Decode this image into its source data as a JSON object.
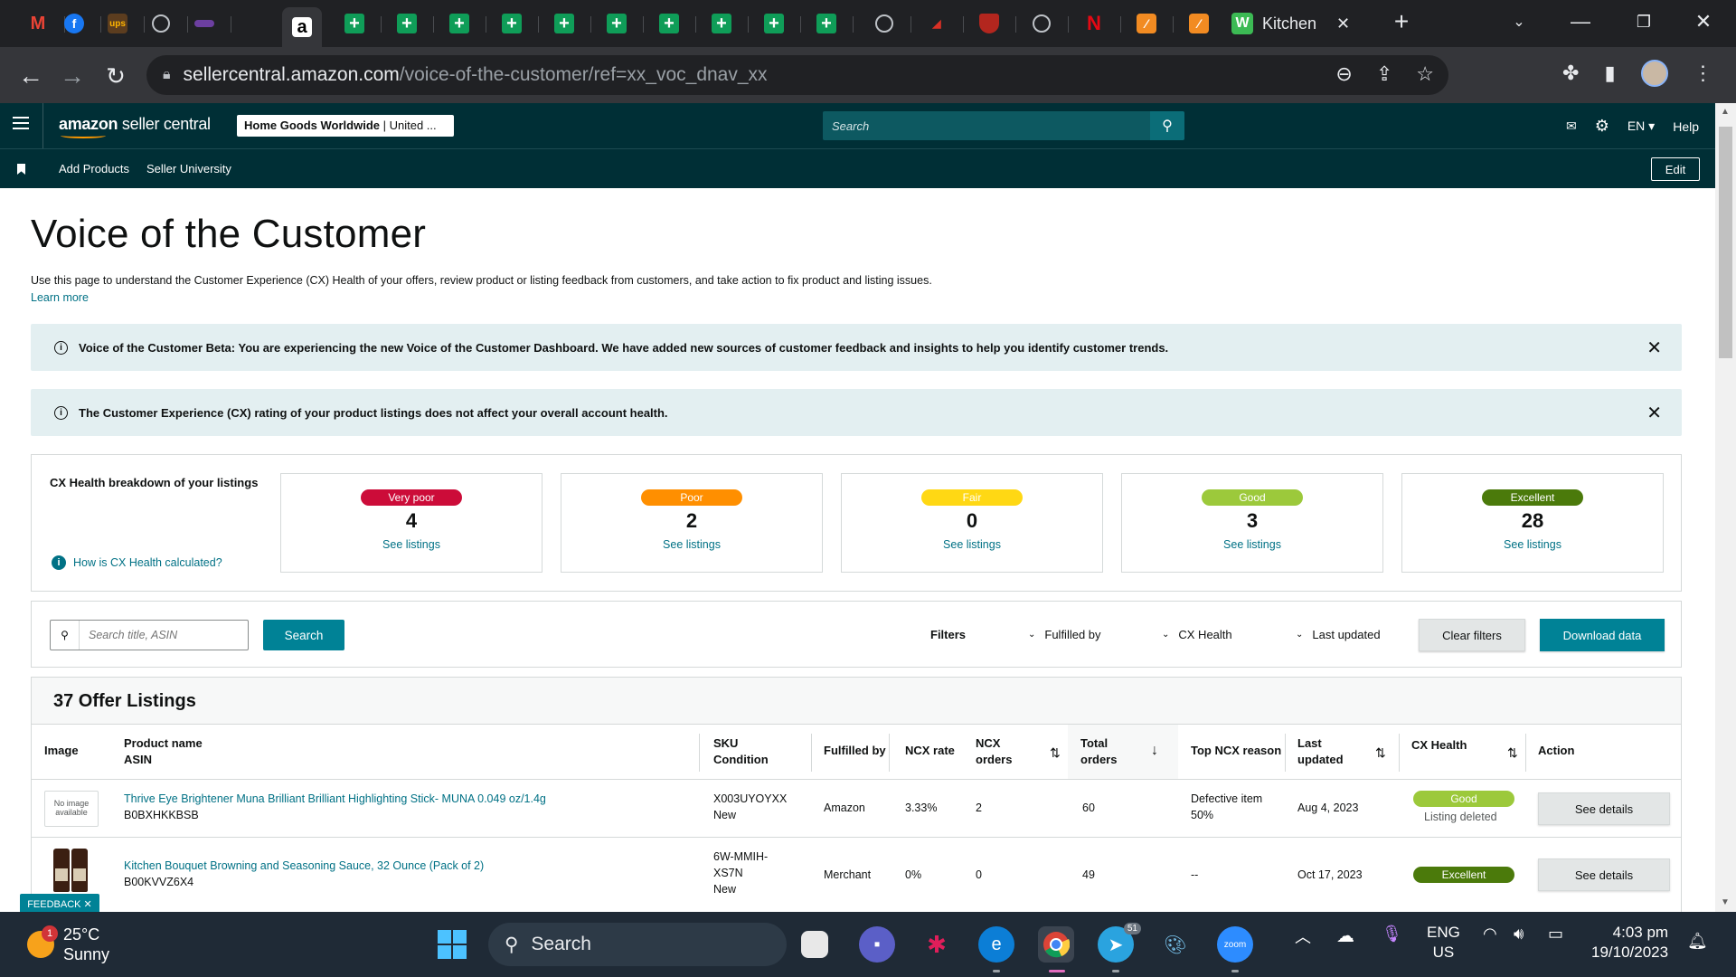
{
  "browser": {
    "tabs": [
      {
        "icon": "gmail-icon",
        "glyph": "M",
        "color": "#ea4335"
      },
      {
        "icon": "facebook-icon",
        "glyph": "f",
        "color": "#1877f2"
      },
      {
        "icon": "ups-icon",
        "glyph": "ups",
        "color": "#5c3d1f"
      },
      {
        "icon": "globe-icon",
        "glyph": "",
        "color": ""
      },
      {
        "icon": "media-icon",
        "glyph": "▬",
        "color": "#6c3fa0"
      }
    ],
    "active_tab_icon": "amazon-icon",
    "sheet_tab_count": 10,
    "kitchen_tab": {
      "title": "Kitchen",
      "close": "✕"
    },
    "new_tab": "+",
    "url_host": "sellercentral.amazon.com",
    "url_path": "/voice-of-the-customer/ref=xx_voc_dnav_xx"
  },
  "header": {
    "logo_bold": "amazon",
    "logo_rest": " seller central",
    "store_bold": "Home Goods Worldwide",
    "store_rest": " | United ...",
    "search_placeholder": "Search",
    "language": "EN",
    "help": "Help"
  },
  "nav": {
    "add_products": "Add Products",
    "seller_university": "Seller University",
    "edit": "Edit"
  },
  "page": {
    "title": "Voice of the Customer",
    "intro": "Use this page to understand the Customer Experience (CX) Health of your offers, review product or listing feedback from customers, and take action to fix product and listing issues.",
    "learn_more": "Learn more",
    "alert1": "Voice of the Customer Beta: You are experiencing the new Voice of the Customer Dashboard. We have added new sources of customer feedback and insights to help you identify customer trends.",
    "alert2": "The Customer Experience (CX) rating of your product listings does not affect your overall account health."
  },
  "cx_health": {
    "title": "CX Health breakdown of your listings",
    "how_link": "How is CX Health calculated?",
    "see_listings": "See listings",
    "cards": [
      {
        "label": "Very poor",
        "count": "4",
        "color": "#cc0c39"
      },
      {
        "label": "Poor",
        "count": "2",
        "color": "#ff8f00"
      },
      {
        "label": "Fair",
        "count": "0",
        "color": "#ffd814"
      },
      {
        "label": "Good",
        "count": "3",
        "color": "#9cc93b"
      },
      {
        "label": "Excellent",
        "count": "28",
        "color": "#4b7a0b"
      }
    ]
  },
  "filters": {
    "search_placeholder": "Search title, ASIN",
    "search_button": "Search",
    "filters_label": "Filters",
    "fulfilled_by": "Fulfilled by",
    "cx_health": "CX Health",
    "last_updated": "Last updated",
    "clear": "Clear filters",
    "download": "Download data"
  },
  "listings": {
    "heading": "37 Offer Listings",
    "columns": {
      "image": "Image",
      "product_name": "Product name",
      "asin": "ASIN",
      "sku": "SKU",
      "condition": "Condition",
      "fulfilled_by": "Fulfilled by",
      "ncx_rate": "NCX rate",
      "ncx_orders": "NCX orders",
      "total_orders": "Total orders",
      "top_reason": "Top NCX reason",
      "last_updated": "Last updated",
      "cx_health": "CX Health",
      "action": "Action"
    },
    "rows": [
      {
        "image": "No image available",
        "name": "Thrive Eye Brightener Muna Brilliant Brilliant Highlighting Stick- MUNA 0.049 oz/1.4g",
        "asin": "B0BXHKKBSB",
        "sku": "X003UYOYXX",
        "condition": "New",
        "fulfilled_by": "Amazon",
        "ncx_rate": "3.33%",
        "ncx_orders": "2",
        "total_orders": "60",
        "top_reason": "Defective item",
        "top_reason_pct": "50%",
        "last_updated": "Aug 4, 2023",
        "health": "Good",
        "health_color": "#9cc93b",
        "health_note": "Listing deleted",
        "action": "See details"
      },
      {
        "name": "Kitchen Bouquet Browning and Seasoning Sauce, 32 Ounce (Pack of 2)",
        "asin": "B00KVVZ6X4",
        "sku": "6W-MMIH-XS7N",
        "condition": "New",
        "fulfilled_by": "Merchant",
        "ncx_rate": "0%",
        "ncx_orders": "0",
        "total_orders": "49",
        "top_reason": "--",
        "last_updated": "Oct 17, 2023",
        "health": "Excellent",
        "health_color": "#4b7a0b",
        "action": "See details"
      }
    ]
  },
  "feedback_tab": "FEEDBACK ✕",
  "taskbar": {
    "weather_temp": "25°C",
    "weather_desc": "Sunny",
    "weather_badge": "1",
    "search": "Search",
    "telegram_badge": "51",
    "lang_top": "ENG",
    "lang_bottom": "US",
    "time": "4:03 pm",
    "date": "19/10/2023"
  }
}
